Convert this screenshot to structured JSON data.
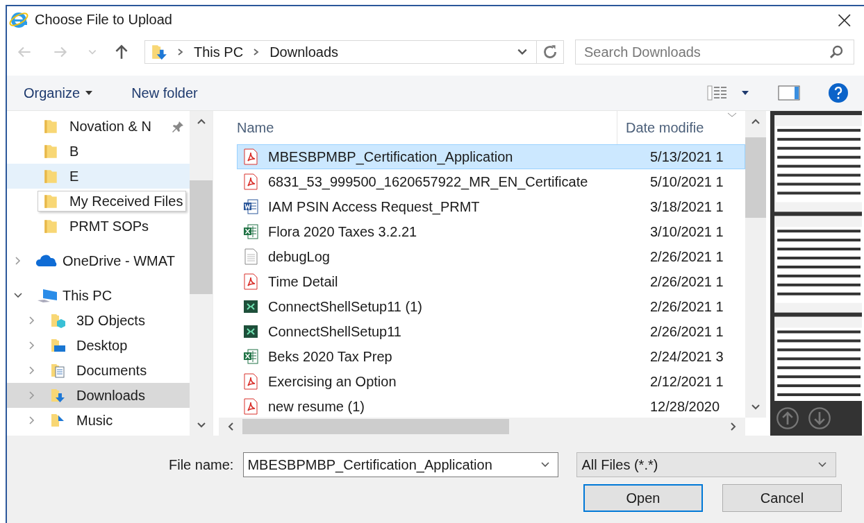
{
  "window": {
    "title": "Choose File to Upload",
    "close": "×"
  },
  "address_bar": {
    "path": [
      "This PC",
      "Downloads"
    ]
  },
  "search": {
    "placeholder": "Search Downloads"
  },
  "toolbar": {
    "organize": "Organize",
    "new_folder": "New folder"
  },
  "quick_access_items": [
    {
      "label": "Novation & N",
      "kind": "folder",
      "pinned": true,
      "hovered": false,
      "selected": false,
      "tooltip": false
    },
    {
      "label": "B",
      "kind": "folder",
      "pinned": false,
      "hovered": false,
      "selected": false,
      "tooltip": false
    },
    {
      "label": "E",
      "kind": "folder",
      "pinned": false,
      "hovered": true,
      "selected": false,
      "tooltip": false
    },
    {
      "label": "My Received Files",
      "kind": "folder",
      "pinned": false,
      "hovered": false,
      "selected": false,
      "tooltip": true
    },
    {
      "label": "PRMT SOPs",
      "kind": "folder",
      "pinned": false,
      "hovered": false,
      "selected": false,
      "tooltip": false
    }
  ],
  "tree": [
    {
      "label": "OneDrive - WMAT",
      "kind": "cloud",
      "expanded": false,
      "hovered": false,
      "selected": false
    },
    {
      "label": "This PC",
      "kind": "pc",
      "expanded": true,
      "hovered": false,
      "selected": false,
      "children": [
        {
          "label": "3D Objects",
          "kind": "cube",
          "expanded": false,
          "hovered": false,
          "selected": false
        },
        {
          "label": "Desktop",
          "kind": "desktop",
          "expanded": false,
          "hovered": false,
          "selected": false
        },
        {
          "label": "Documents",
          "kind": "documents",
          "expanded": false,
          "hovered": false,
          "selected": false
        },
        {
          "label": "Downloads",
          "kind": "downloads",
          "expanded": false,
          "hovered": false,
          "selected": true
        },
        {
          "label": "Music",
          "kind": "music",
          "expanded": false,
          "hovered": false,
          "selected": false
        }
      ]
    }
  ],
  "file_list": {
    "columns": [
      "Name",
      "Date modifie"
    ],
    "rows": [
      {
        "name": "MBESBPMBP_Certification_Application",
        "date": "5/13/2021 1",
        "kind": "pdf",
        "selected": true
      },
      {
        "name": "6831_53_999500_1620657922_MR_EN_Certificate",
        "date": "5/10/2021 1",
        "kind": "pdf",
        "selected": false
      },
      {
        "name": "IAM PSIN Access Request_PRMT",
        "date": "3/18/2021 1",
        "kind": "word",
        "selected": false
      },
      {
        "name": "Flora 2020 Taxes 3.2.21",
        "date": "3/10/2021 1",
        "kind": "excel",
        "selected": false
      },
      {
        "name": "debugLog",
        "date": "2/26/2021 1",
        "kind": "text",
        "selected": false
      },
      {
        "name": "Time Detail",
        "date": "2/26/2021 1",
        "kind": "pdf",
        "selected": false
      },
      {
        "name": "ConnectShellSetup11 (1)",
        "date": "2/26/2021 1",
        "kind": "app",
        "selected": false
      },
      {
        "name": "ConnectShellSetup11",
        "date": "2/26/2021 1",
        "kind": "app",
        "selected": false
      },
      {
        "name": "Beks 2020 Tax Prep",
        "date": "2/24/2021 3",
        "kind": "excel",
        "selected": false
      },
      {
        "name": "Exercising an Option",
        "date": "2/12/2021 1",
        "kind": "pdf",
        "selected": false
      },
      {
        "name": "new resume (1)",
        "date": "12/28/2020",
        "kind": "pdf",
        "selected": false
      }
    ]
  },
  "footer": {
    "file_name_label": "File name:",
    "file_name_value": "MBESBPMBP_Certification_Application",
    "filter": "All Files (*.*)",
    "buttons": [
      {
        "label": "Open",
        "default": true
      },
      {
        "label": "Cancel",
        "default": false
      }
    ]
  }
}
